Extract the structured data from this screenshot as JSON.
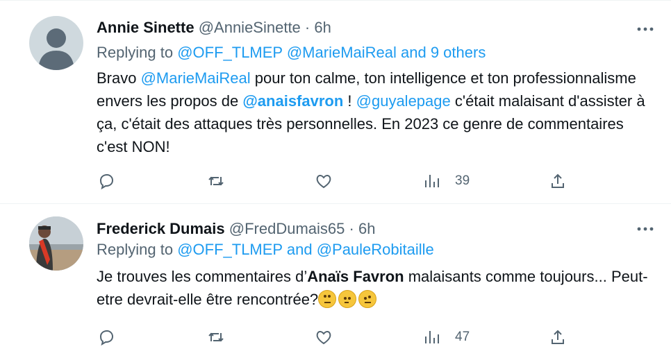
{
  "tweets": [
    {
      "name": "Annie Sinette",
      "handle": "@AnnieSinette",
      "dot": "·",
      "time": "6h",
      "reply_prefix": "Replying to",
      "reply_targets": [
        "@OFF_TLMEP",
        "@MarieMaiReal",
        "and 9 others"
      ],
      "body": {
        "p1": "Bravo ",
        "m1": "@MarieMaiReal",
        "p2": " pour ton calme, ton intelligence et ton professionnalisme envers les propos de ",
        "m2": "@anaisfavron",
        "p3": " ! ",
        "m3": "@guyalepage",
        "p4": " c'était malaisant d'assister à ça, c'était des attaques très personnelles. En 2023 ce genre de commentaires c'est NON!"
      },
      "views": "39"
    },
    {
      "name": "Frederick Dumais",
      "handle": "@FredDumais65",
      "dot": "·",
      "time": "6h",
      "reply_prefix": "Replying to",
      "reply_targets": [
        "@OFF_TLMEP",
        "and",
        "@PauleRobitaille"
      ],
      "body": {
        "p1": "Je trouves les commentaires d’",
        "b1": "Anaïs Favron",
        "p2": " malaisants comme toujours... Peut-etre devrait-elle être rencontrée?"
      },
      "emojis": [
        "face-with-rolling-eyes",
        "thinking-face",
        "face-with-raised-eyebrow"
      ],
      "views": "47"
    }
  ],
  "icons": {
    "more": "more-icon",
    "reply": "reply-icon",
    "retweet": "retweet-icon",
    "like": "like-icon",
    "views": "views-icon",
    "share": "share-icon"
  },
  "colors": {
    "link": "#1d9bf0",
    "secondary_text": "#536471",
    "primary_text": "#0f1419",
    "divider": "#eff3f4"
  }
}
